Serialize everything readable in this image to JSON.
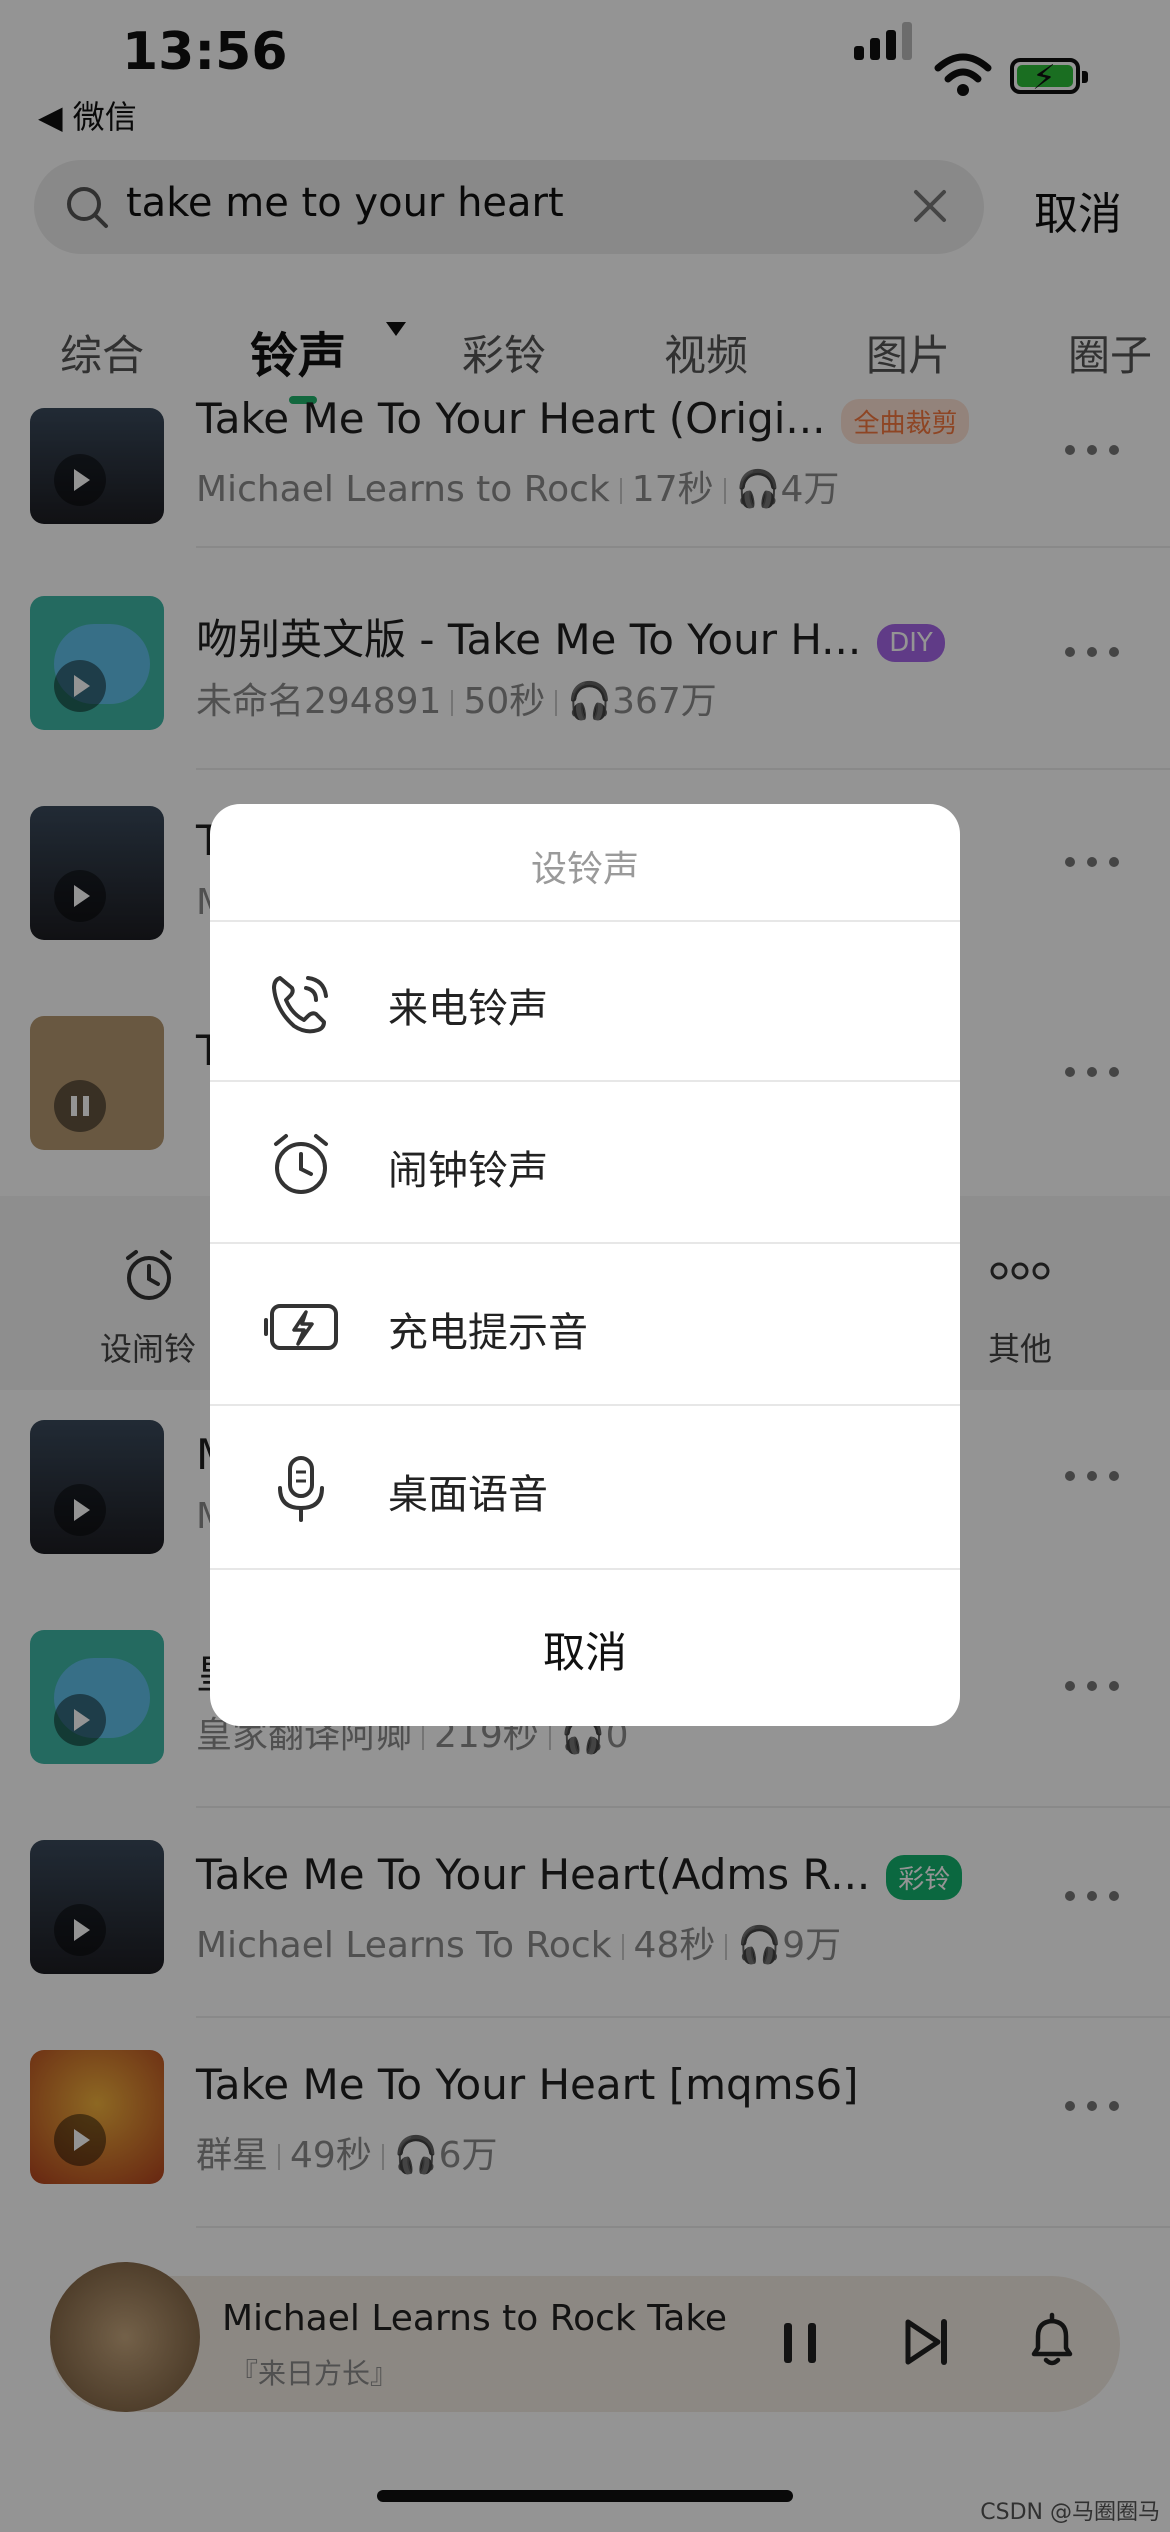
{
  "status_bar": {
    "time": "13:56",
    "back_app": "◀ 微信"
  },
  "search": {
    "query": "take me to your heart",
    "cancel_label": "取消"
  },
  "tabs": [
    {
      "label": "综合"
    },
    {
      "label": "铃声"
    },
    {
      "label": "彩铃"
    },
    {
      "label": "视频"
    },
    {
      "label": "图片"
    },
    {
      "label": "圈子"
    }
  ],
  "list": [
    {
      "title": "Take Me To Your Heart (Origi...",
      "badge": "全曲裁剪",
      "badge_color": "#f4773f",
      "artist": "Michael Learns to Rock",
      "duration": "17秒",
      "plays": "4万"
    },
    {
      "title": "吻别英文版 - Take Me To Your H...",
      "badge": "DIY",
      "badge_color": "#a567e8",
      "artist": "未命名294891",
      "duration": "50秒",
      "plays": "367万"
    },
    {
      "title": "T",
      "artist": "M"
    },
    {
      "title": "T",
      "artist": "『"
    },
    {
      "title": "M",
      "artist": "M"
    },
    {
      "title": "皇",
      "artist": "皇家翻译阿卿",
      "duration": "219秒",
      "plays": "0"
    },
    {
      "title": "Take Me To Your Heart(Adms R...",
      "badge": "彩铃",
      "badge_color": "#14b36f",
      "artist": "Michael Learns To Rock",
      "duration": "48秒",
      "plays": "9万"
    },
    {
      "title": "Take Me To Your Heart [mqms6]",
      "artist": "群星",
      "duration": "49秒",
      "plays": "6万"
    }
  ],
  "action_bar": {
    "alarm_label": "设闹铃",
    "other_label": "其他"
  },
  "now_playing": {
    "title": "Michael Learns to Rock   Take",
    "subtitle": "『来日方长』"
  },
  "sheet": {
    "title": "设铃声",
    "options": [
      {
        "label": "来电铃声",
        "icon": "phone-ringing-icon"
      },
      {
        "label": "闹钟铃声",
        "icon": "alarm-clock-icon"
      },
      {
        "label": "充电提示音",
        "icon": "battery-charging-icon"
      },
      {
        "label": "桌面语音",
        "icon": "microphone-icon"
      }
    ],
    "cancel_label": "取消"
  },
  "watermark": "CSDN @马圈圈马",
  "colors": {
    "accent_green": "#1fb36b",
    "diy_purple": "#a567e8",
    "caiyin_green": "#14b36f",
    "crop_orange": "#f4773f"
  }
}
